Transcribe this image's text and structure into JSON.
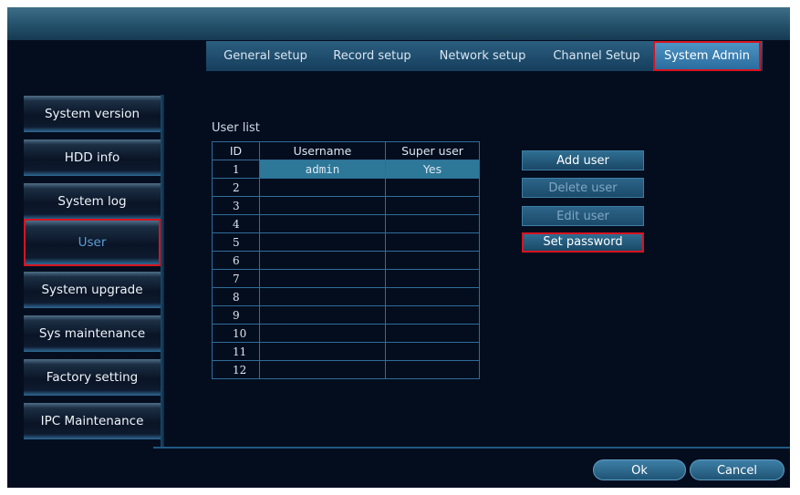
{
  "tabs": [
    "General setup",
    "Record setup",
    "Network setup",
    "Channel Setup",
    "System Admin"
  ],
  "active_tab": "System Admin",
  "sidebar": {
    "items": [
      "System version",
      "HDD info",
      "System log",
      "User",
      "System upgrade",
      "Sys maintenance",
      "Factory setting",
      "IPC Maintenance"
    ],
    "selected": "User"
  },
  "user_list": {
    "label": "User list",
    "columns": [
      "ID",
      "Username",
      "Super user"
    ],
    "rows": [
      {
        "id": "1",
        "username": "admin",
        "super_user": "Yes"
      },
      {
        "id": "2",
        "username": "",
        "super_user": ""
      },
      {
        "id": "3",
        "username": "",
        "super_user": ""
      },
      {
        "id": "4",
        "username": "",
        "super_user": ""
      },
      {
        "id": "5",
        "username": "",
        "super_user": ""
      },
      {
        "id": "6",
        "username": "",
        "super_user": ""
      },
      {
        "id": "7",
        "username": "",
        "super_user": ""
      },
      {
        "id": "8",
        "username": "",
        "super_user": ""
      },
      {
        "id": "9",
        "username": "",
        "super_user": ""
      },
      {
        "id": "10",
        "username": "",
        "super_user": ""
      },
      {
        "id": "11",
        "username": "",
        "super_user": ""
      },
      {
        "id": "12",
        "username": "",
        "super_user": ""
      }
    ],
    "selected_id": "1"
  },
  "actions": {
    "add_user": "Add user",
    "delete_user": "Delete user",
    "edit_user": "Edit user",
    "set_password": "Set password"
  },
  "footer": {
    "ok": "Ok",
    "cancel": "Cancel"
  },
  "colors": {
    "background": "#040d1e",
    "accent": "#2b6d9f",
    "highlight_border": "#d8131f",
    "selected_row": "#2d7898"
  }
}
